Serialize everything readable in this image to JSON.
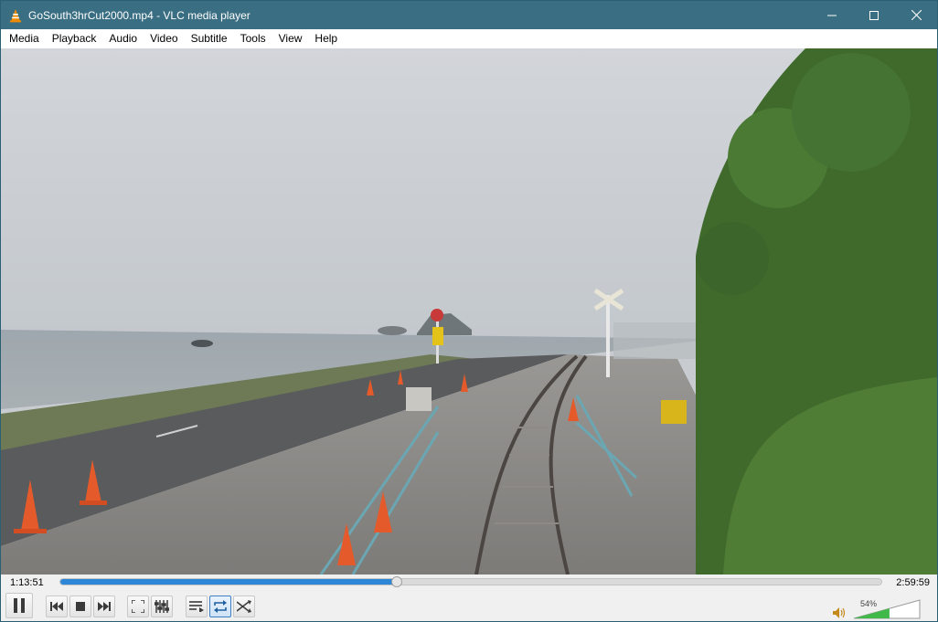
{
  "window": {
    "title": "GoSouth3hrCut2000.mp4 - VLC media player",
    "icon": "vlc-cone-icon",
    "controls": [
      "minimize-icon",
      "maximize-icon",
      "close-icon"
    ]
  },
  "menu": {
    "items": [
      "Media",
      "Playback",
      "Audio",
      "Video",
      "Subtitle",
      "Tools",
      "View",
      "Help"
    ]
  },
  "playback": {
    "elapsed": "1:13:51",
    "total": "2:59:59",
    "progress_fraction": 0.41,
    "accent_color": "#2e86d6"
  },
  "controls": {
    "buttons": [
      "pause-icon",
      "previous-icon",
      "stop-icon",
      "next-icon",
      "fullscreen-icon",
      "extended-settings-icon",
      "playlist-icon",
      "loop-icon",
      "shuffle-icon"
    ],
    "loop_active": true
  },
  "volume": {
    "label": "54%",
    "level_fraction": 0.54,
    "icon": "speaker-icon"
  }
}
